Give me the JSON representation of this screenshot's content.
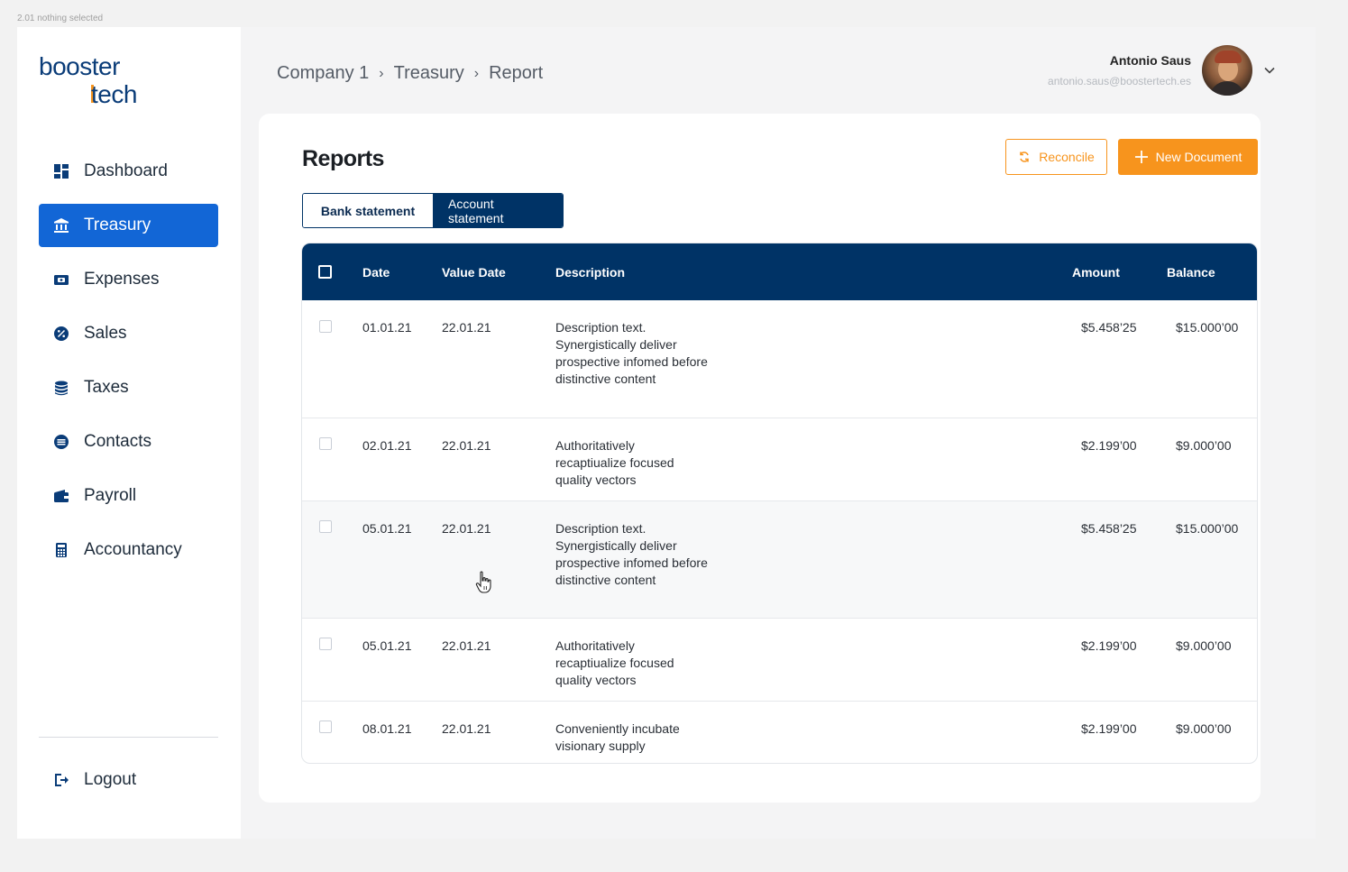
{
  "frame_label": "2.01 nothing selected",
  "logo": {
    "line1": "booster",
    "line2": "tech"
  },
  "sidebar": {
    "items": [
      {
        "label": "Dashboard",
        "icon": "dashboard-icon",
        "active": false
      },
      {
        "label": "Treasury",
        "icon": "bank-icon",
        "active": true
      },
      {
        "label": "Expenses",
        "icon": "wallet-icon",
        "active": false
      },
      {
        "label": "Sales",
        "icon": "percent-icon",
        "active": false
      },
      {
        "label": "Taxes",
        "icon": "coins-icon",
        "active": false
      },
      {
        "label": "Contacts",
        "icon": "contacts-icon",
        "active": false
      },
      {
        "label": "Payroll",
        "icon": "purse-icon",
        "active": false
      },
      {
        "label": "Accountancy",
        "icon": "calculator-icon",
        "active": false
      }
    ],
    "logout": "Logout"
  },
  "breadcrumb": [
    "Company 1",
    "Treasury",
    "Report"
  ],
  "user": {
    "name": "Antonio Saus",
    "email": "antonio.saus@boostertech.es"
  },
  "card": {
    "title": "Reports",
    "reconcile_label": "Reconcile",
    "new_document_label": "New Document",
    "tabs": [
      "Bank statement",
      "Account statement"
    ],
    "selected_tab": "Account statement"
  },
  "table": {
    "columns": [
      "Date",
      "Value Date",
      "Description",
      "Amount",
      "Balance"
    ],
    "rows": [
      {
        "date": "01.01.21",
        "value_date": "22.01.21",
        "description": "Description text. Synergistically deliver prospective infomed before distinctive content",
        "amount": "$5.458’25",
        "balance": "$15.000’00"
      },
      {
        "date": "02.01.21",
        "value_date": "22.01.21",
        "description": "Authoritatively recaptiualize focused quality vectors",
        "amount": "$2.199’00",
        "balance": "$9.000’00"
      },
      {
        "date": "05.01.21",
        "value_date": "22.01.21",
        "description": "Description text. Synergistically deliver prospective infomed before distinctive content",
        "amount": "$5.458’25",
        "balance": "$15.000’00"
      },
      {
        "date": "05.01.21",
        "value_date": "22.01.21",
        "description": "Authoritatively recaptiualize focused quality vectors",
        "amount": "$2.199’00",
        "balance": "$9.000’00"
      },
      {
        "date": "08.01.21",
        "value_date": "22.01.21",
        "description": "Conveniently incubate visionary supply",
        "amount": "$2.199’00",
        "balance": "$9.000’00"
      }
    ]
  },
  "colors": {
    "brand_blue": "#003366",
    "active_blue": "#1266d6",
    "accent_orange": "#f7941d"
  }
}
